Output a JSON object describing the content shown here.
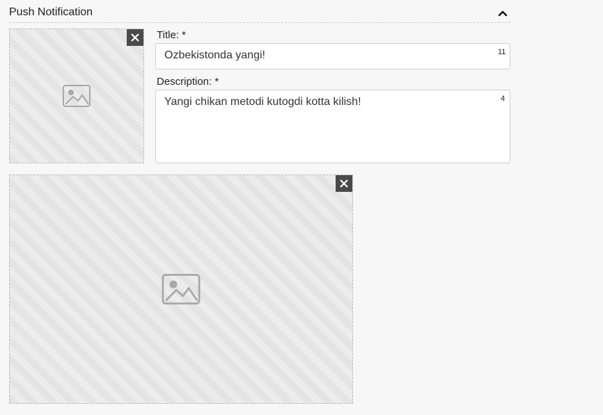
{
  "header": {
    "title": "Push Notification",
    "collapse_icon": "chevron-up-icon"
  },
  "form": {
    "title_label": "Title: *",
    "title_value": "Ozbekistonda yangi!",
    "title_counter": "11",
    "description_label": "Description: *",
    "description_value": "Yangi chikan metodi kutogdi kotta kilish!",
    "description_counter": "4"
  },
  "images": [
    {
      "slot": "primary",
      "remove_icon": "close-icon"
    },
    {
      "slot": "secondary",
      "remove_icon": "close-icon"
    }
  ],
  "colors": {
    "background": "#f7f7f7",
    "remove_button": "#4a4a4a",
    "field_border": "#cfcfcf"
  }
}
